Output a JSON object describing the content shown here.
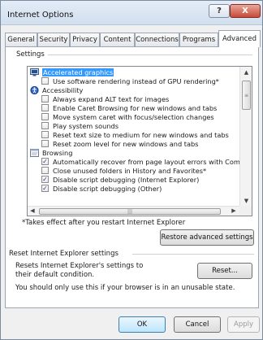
{
  "window": {
    "title": "Internet Options",
    "help_label": "?",
    "close_label": "X"
  },
  "tabs": [
    {
      "label": "General"
    },
    {
      "label": "Security"
    },
    {
      "label": "Privacy"
    },
    {
      "label": "Content"
    },
    {
      "label": "Connections"
    },
    {
      "label": "Programs"
    },
    {
      "label": "Advanced"
    }
  ],
  "active_tab": "Advanced",
  "settings": {
    "label": "Settings",
    "rows": [
      {
        "type": "category",
        "text": "Accelerated graphics",
        "selected": true,
        "icon": "monitor-icon"
      },
      {
        "type": "checkbox",
        "text": "Use software rendering instead of GPU rendering*",
        "checked": false
      },
      {
        "type": "category",
        "text": "Accessibility",
        "icon": "accessibility-icon"
      },
      {
        "type": "checkbox",
        "text": "Always expand ALT text for images",
        "checked": false
      },
      {
        "type": "checkbox",
        "text": "Enable Caret Browsing for new windows and tabs",
        "checked": false
      },
      {
        "type": "checkbox",
        "text": "Move system caret with focus/selection changes",
        "checked": false
      },
      {
        "type": "checkbox",
        "text": "Play system sounds",
        "checked": false
      },
      {
        "type": "checkbox",
        "text": "Reset text size to medium for new windows and tabs",
        "checked": false
      },
      {
        "type": "checkbox",
        "text": "Reset zoom level for new windows and tabs",
        "checked": false
      },
      {
        "type": "category",
        "text": "Browsing",
        "icon": "browsing-icon"
      },
      {
        "type": "checkbox",
        "text": "Automatically recover from page layout errors with Compa",
        "checked": true
      },
      {
        "type": "checkbox",
        "text": "Close unused folders in History and Favorites*",
        "checked": false
      },
      {
        "type": "checkbox",
        "text": "Disable script debugging (Internet Explorer)",
        "checked": true
      },
      {
        "type": "checkbox",
        "text": "Disable script debugging (Other)",
        "checked": true
      }
    ],
    "restart_note": "*Takes effect after you restart Internet Explorer",
    "restore_button": "Restore advanced settings"
  },
  "reset": {
    "label": "Reset Internet Explorer settings",
    "description": "Resets Internet Explorer's settings to their default condition.",
    "button": "Reset...",
    "warning": "You should only use this if your browser is in an unusable state."
  },
  "footer": {
    "ok": "OK",
    "cancel": "Cancel",
    "apply": "Apply"
  },
  "colors": {
    "selection": "#3399ff",
    "checkmark": "#1e3a8a",
    "close_button": "#c64b3a"
  }
}
